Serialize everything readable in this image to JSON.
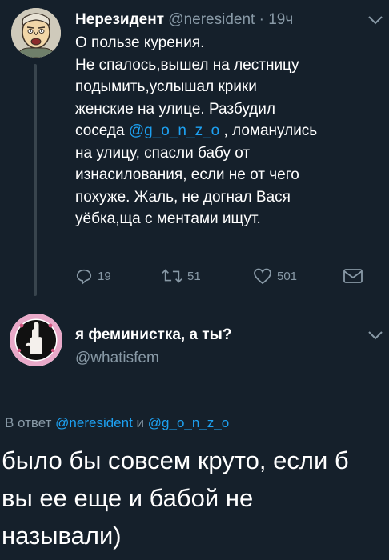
{
  "tweet": {
    "author_name": "Нерезидент",
    "author_handle": "@neresident",
    "separator": "·",
    "time": "19ч",
    "avatar": "cartoon-man-avatar",
    "text_lines": [
      "О пользе курения.",
      "Не спалось,вышел на лестницу",
      "подымить,услышал крики",
      "женские на улице. Разбудил",
      "соседа ",
      "на улицу, спасли бабу от",
      "изнасилования, если не от чего",
      "похуже. Жаль, не догнал Вася",
      "уёбка,ща с ментами ищут."
    ],
    "mention": "@g_o_n_z_o",
    "line5_tail": " , ломанулись",
    "actions": {
      "reply_icon": "reply-icon",
      "reply_count": "19",
      "retweet_icon": "retweet-icon",
      "retweet_count": "51",
      "like_icon": "heart-icon",
      "like_count": "501",
      "dm_icon": "envelope-icon"
    }
  },
  "reply": {
    "author_name": "я феминистка, а ты?",
    "author_handle": "@whatisfem",
    "avatar": "feminist-hand-avatar",
    "reply_prefix": "В ответ ",
    "reply_mention1": "@neresident",
    "reply_and": " и ",
    "reply_mention2": "@g_o_n_z_o",
    "text_lines": [
      "было бы совсем круто, если б",
      "вы ее еще и бабой не",
      "называли)"
    ]
  },
  "colors": {
    "background": "#15202b",
    "text": "#ffffff",
    "secondary": "#8899a6",
    "accent": "#1da1f2"
  }
}
